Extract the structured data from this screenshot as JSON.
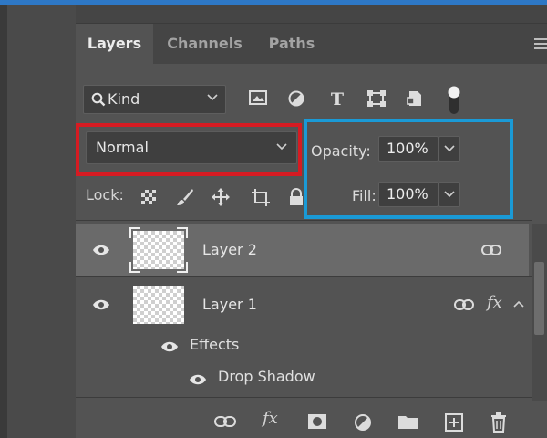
{
  "tabs": [
    {
      "label": "Layers",
      "active": true
    },
    {
      "label": "Channels",
      "active": false
    },
    {
      "label": "Paths",
      "active": false
    }
  ],
  "filter": {
    "kind_label": "Kind",
    "icons": [
      "image-filter-icon",
      "adjustment-filter-icon",
      "type-filter-icon",
      "shape-filter-icon",
      "smart-object-filter-icon",
      "filter-toggle-icon"
    ]
  },
  "blend": {
    "mode": "Normal"
  },
  "opacity": {
    "label": "Opacity:",
    "value": "100%"
  },
  "fill": {
    "label": "Fill:",
    "value": "100%"
  },
  "lock": {
    "label": "Lock:",
    "icons": [
      "lock-transparent-pixels-icon",
      "lock-image-pixels-icon",
      "lock-position-icon",
      "lock-artboard-icon",
      "lock-all-icon"
    ]
  },
  "layers": [
    {
      "name": "Layer 2",
      "selected": true,
      "visible": true,
      "linked": true,
      "has_fx": false
    },
    {
      "name": "Layer 1",
      "selected": false,
      "visible": true,
      "linked": true,
      "has_fx": true
    }
  ],
  "effects": {
    "label": "Effects",
    "items": [
      "Drop Shadow"
    ]
  },
  "footer_icons": [
    "link-layers-icon",
    "add-layer-style-icon",
    "add-mask-icon",
    "new-adjustment-layer-icon",
    "new-group-icon",
    "new-layer-icon",
    "delete-layer-icon"
  ],
  "colors": {
    "red_highlight": "#d61b22",
    "blue_highlight": "#1a9ad6",
    "panel_bg": "#535353",
    "selected_row": "#6a6a6a"
  }
}
